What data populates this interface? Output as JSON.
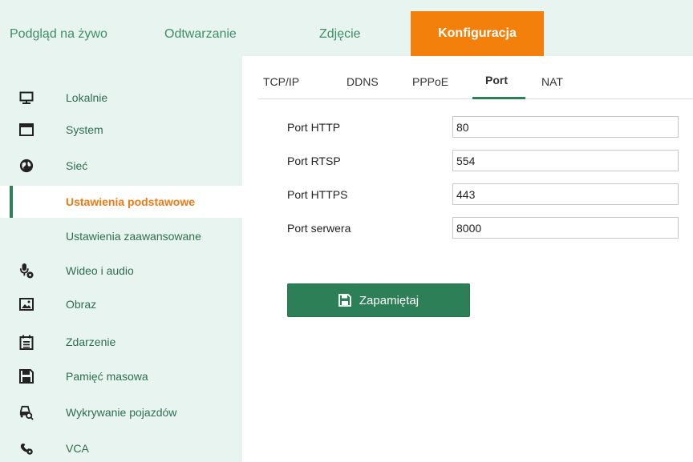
{
  "topnav": {
    "tabs": [
      {
        "label": "Podgląd na żywo"
      },
      {
        "label": "Odtwarzanie"
      },
      {
        "label": "Zdjęcie"
      },
      {
        "label": "Konfiguracja",
        "active": true
      }
    ]
  },
  "sidebar": {
    "items": [
      {
        "label": "Lokalnie",
        "icon": "monitor-icon"
      },
      {
        "label": "System",
        "icon": "window-icon"
      },
      {
        "label": "Sieć",
        "icon": "globe-icon"
      },
      {
        "label": "Ustawienia podstawowe",
        "sub": true,
        "selected": true
      },
      {
        "label": "Ustawienia zaawansowane",
        "sub": true
      },
      {
        "label": "Wideo i audio",
        "icon": "microphone-settings-icon"
      },
      {
        "label": "Obraz",
        "icon": "image-icon"
      },
      {
        "label": "Zdarzenie",
        "icon": "calendar-list-icon"
      },
      {
        "label": "Pamięć masowa",
        "icon": "floppy-disk-icon"
      },
      {
        "label": "Wykrywanie pojazdów",
        "icon": "vehicle-search-icon"
      },
      {
        "label": "VCA",
        "icon": "vca-settings-icon"
      }
    ]
  },
  "subtabs": [
    {
      "label": "TCP/IP"
    },
    {
      "label": "DDNS"
    },
    {
      "label": "PPPoE"
    },
    {
      "label": "Port",
      "active": true
    },
    {
      "label": "NAT"
    }
  ],
  "form": {
    "fields": [
      {
        "label": "Port HTTP",
        "value": "80"
      },
      {
        "label": "Port RTSP",
        "value": "554"
      },
      {
        "label": "Port HTTPS",
        "value": "443"
      },
      {
        "label": "Port serwera",
        "value": "8000"
      }
    ],
    "save_label": "Zapamiętaj"
  },
  "colors": {
    "accent_orange": "#f4800c",
    "primary_green": "#2d7f57",
    "nav_background": "#e7f4ef",
    "nav_text": "#3f8f66"
  }
}
